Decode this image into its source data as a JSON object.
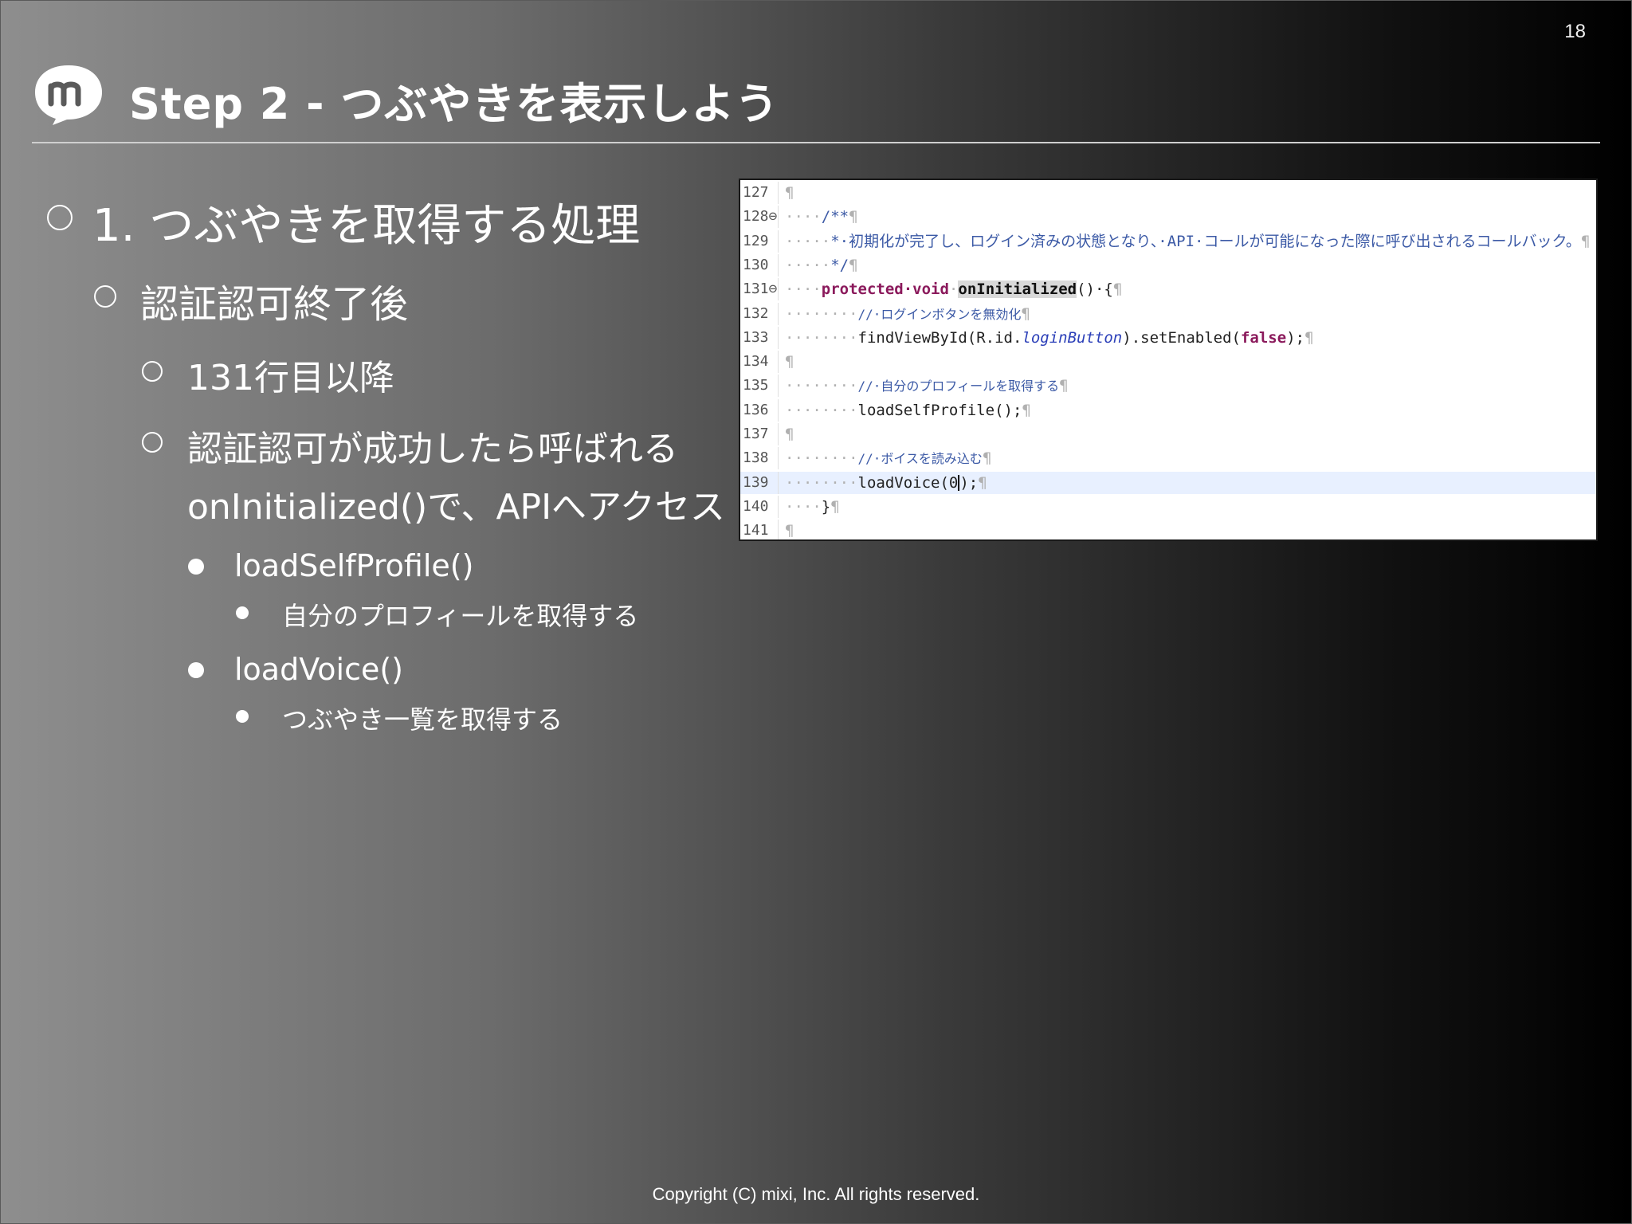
{
  "page_number": "18",
  "title": "Step 2 - つぶやきを表示しよう",
  "bullets": {
    "l1": "1. つぶやきを取得する処理",
    "l2": "認証認可終了後",
    "l3a": "131行目以降",
    "l3b_line1": "認証認可が成功したら呼ばれる",
    "l3b_line2": "onInitialized()で、APIへアクセス",
    "l4a": "loadSelfProfile()",
    "l5a": "自分のプロフィールを取得する",
    "l4b": "loadVoice()",
    "l5b": "つぶやき一覧を取得する"
  },
  "code": {
    "lines": [
      {
        "num": "127",
        "pil": "¶"
      },
      {
        "num": "128⊖",
        "dots": "····",
        "doc": "/**",
        "pil": "¶"
      },
      {
        "num": "129",
        "dots": "·····",
        "doc": "*·初期化が完了し、ログイン済みの状態となり、·API·コールが可能になった際に呼び出されるコールバック。",
        "pil": "¶"
      },
      {
        "num": "130",
        "dots": "·····",
        "doc": "*/",
        "pil": "¶"
      },
      {
        "num": "131⊖",
        "dots": "····",
        "kw": "protected·void",
        "sp": "·",
        "fn": "onInitialized",
        "rest": "()·{",
        "pil": "¶"
      },
      {
        "num": "132",
        "dots": "········",
        "cm": "//·ログインボタンを無効化",
        "pil": "¶"
      },
      {
        "num": "133",
        "dots": "········",
        "pre": "findViewById(R.id.",
        "fld": "loginButton",
        "post": ").setEnabled(",
        "kw2": "false",
        "end": ");",
        "pil": "¶"
      },
      {
        "num": "134",
        "pil": "¶"
      },
      {
        "num": "135",
        "dots": "········",
        "cm": "//·自分のプロフィールを取得する",
        "pil": "¶"
      },
      {
        "num": "136",
        "dots": "········",
        "pre": "loadSelfProfile();",
        "pil": "¶"
      },
      {
        "num": "137",
        "pil": "¶"
      },
      {
        "num": "138",
        "dots": "········",
        "cm": "//·ボイスを読み込む",
        "pil": "¶"
      },
      {
        "num": "139",
        "dots": "········",
        "pre": "loadVoice(0",
        "end": ");",
        "pil": "¶"
      },
      {
        "num": "140",
        "dots": "····",
        "pre": "}",
        "pil": "¶"
      },
      {
        "num": "141",
        "pil": "¶"
      }
    ]
  },
  "footer": "Copyright (C) mixi, Inc. All rights reserved.",
  "colors": {
    "title_rule": "#cfcfcf",
    "code_keyword": "#8b1a5c",
    "code_comment": "#3c5aa6",
    "active_line": "#e8f0ff"
  }
}
